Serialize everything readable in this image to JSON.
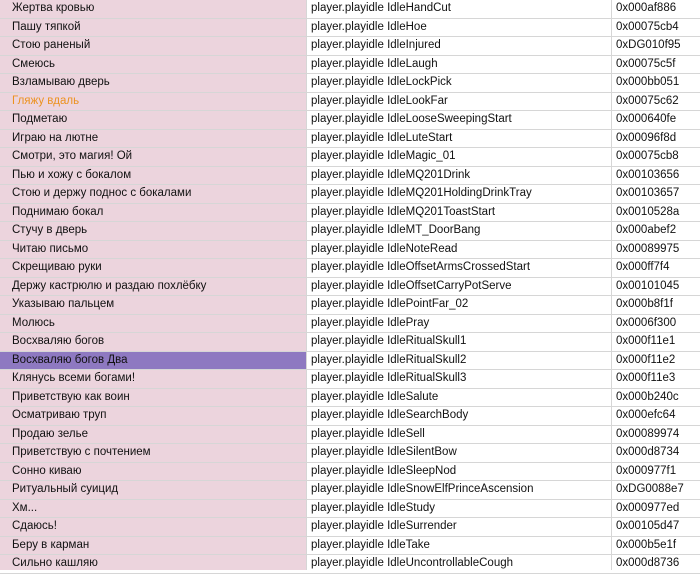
{
  "rows": [
    {
      "name": "Жертва кровью",
      "id": "player.playidle IdleHandCut",
      "code": "0x000af886"
    },
    {
      "name": "Пашу тяпкой",
      "id": "player.playidle IdleHoe",
      "code": "0x00075cb4"
    },
    {
      "name": "Стою раненый",
      "id": "player.playidle IdleInjured",
      "code": "0xDG010f95"
    },
    {
      "name": "Смеюсь",
      "id": "player.playidle IdleLaugh",
      "code": "0x00075c5f"
    },
    {
      "name": "Взламываю дверь",
      "id": "player.playidle IdleLockPick",
      "code": "0x000bb051"
    },
    {
      "name": "Гляжу вдаль",
      "id": "player.playidle IdleLookFar",
      "code": "0x00075c62"
    },
    {
      "name": "Подметаю",
      "id": "player.playidle IdleLooseSweepingStart",
      "code": "0x000640fe"
    },
    {
      "name": "Играю на лютне",
      "id": "player.playidle IdleLuteStart",
      "code": "0x00096f8d"
    },
    {
      "name": "Смотри, это магия! Ой",
      "id": "player.playidle IdleMagic_01",
      "code": "0x00075cb8"
    },
    {
      "name": "Пью и хожу с бокалом",
      "id": "player.playidle IdleMQ201Drink",
      "code": "0x00103656"
    },
    {
      "name": "Стою и держу поднос с бокалами",
      "id": "player.playidle IdleMQ201HoldingDrinkTray",
      "code": "0x00103657"
    },
    {
      "name": "Поднимаю бокал",
      "id": "player.playidle IdleMQ201ToastStart",
      "code": "0x0010528a"
    },
    {
      "name": "Стучу в дверь",
      "id": "player.playidle IdleMT_DoorBang",
      "code": "0x000abef2"
    },
    {
      "name": "Читаю письмо",
      "id": "player.playidle IdleNoteRead",
      "code": "0x00089975"
    },
    {
      "name": "Скрещиваю руки",
      "id": "player.playidle IdleOffsetArmsCrossedStart",
      "code": "0x000ff7f4"
    },
    {
      "name": "Держу кастрюлю и раздаю похлёбку",
      "id": "player.playidle IdleOffsetCarryPotServe",
      "code": "0x00101045"
    },
    {
      "name": "Указываю пальцем",
      "id": "player.playidle IdlePointFar_02",
      "code": "0x000b8f1f"
    },
    {
      "name": "Молюсь",
      "id": "player.playidle IdlePray",
      "code": "0x0006f300"
    },
    {
      "name": "Восхваляю богов",
      "id": "player.playidle IdleRitualSkull1",
      "code": "0x000f11e1"
    },
    {
      "name": "Восхваляю богов Два",
      "id": "player.playidle IdleRitualSkull2",
      "code": "0x000f11e2"
    },
    {
      "name": "Клянусь всеми богами!",
      "id": "player.playidle IdleRitualSkull3",
      "code": "0x000f11e3"
    },
    {
      "name": "Приветствую как воин",
      "id": "player.playidle IdleSalute",
      "code": "0x000b240c"
    },
    {
      "name": "Осматриваю труп",
      "id": "player.playidle IdleSearchBody",
      "code": "0x000efc64"
    },
    {
      "name": "Продаю зелье",
      "id": "player.playidle IdleSell",
      "code": "0x00089974"
    },
    {
      "name": "Приветствую с почтением",
      "id": "player.playidle IdleSilentBow",
      "code": "0x000d8734"
    },
    {
      "name": "Сонно киваю",
      "id": "player.playidle IdleSleepNod",
      "code": "0x000977f1"
    },
    {
      "name": "Ритуальный суицид",
      "id": "player.playidle IdleSnowElfPrinceAscension",
      "code": "0xDG0088e7"
    },
    {
      "name": "Хм...",
      "id": "player.playidle IdleStudy",
      "code": "0x000977ed"
    },
    {
      "name": "Сдаюсь!",
      "id": "player.playidle IdleSurrender",
      "code": "0x00105d47"
    },
    {
      "name": "Беру в карман",
      "id": "player.playidle IdleTake",
      "code": "0x000b5e1f"
    },
    {
      "name": "Сильно кашляю",
      "id": "player.playidle IdleUncontrollableCough",
      "code": "0x000d8736"
    }
  ],
  "selected_row": 19,
  "highlighted_row": 5,
  "colors": {
    "name_column_bg": "#ecd4dd",
    "selected_bg": "#8e79c1",
    "highlight_text": "#ec9220",
    "grid": "#d6d6d6"
  }
}
